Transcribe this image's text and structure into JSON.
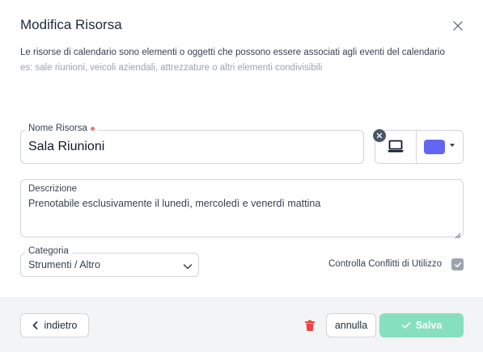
{
  "dialog": {
    "title": "Modifica Risorsa",
    "description": "Le risorse di calendario sono elementi o oggetti che possono essere associati agli eventi del calendario",
    "examples": "es: sale riunioni, veicoli aziendali, attrezzature o altri elementi condivisibili"
  },
  "form": {
    "name": {
      "label": "Nome Risorsa",
      "value": "Sala Riunioni",
      "required": true
    },
    "icon": {
      "name": "laptop-icon"
    },
    "color": {
      "value": "#6366f1"
    },
    "description": {
      "label": "Descrizione",
      "value": "Prenotabile esclusivamente il lunedì, mercoledì e venerdì mattina"
    },
    "category": {
      "label": "Categoria",
      "value": "Strumenti / Altro"
    },
    "conflicts": {
      "label": "Controlla Conflitti di Utilizzo",
      "checked": true
    }
  },
  "footer": {
    "back_label": "indietro",
    "cancel_label": "annulla",
    "save_label": "Salva"
  },
  "colors": {
    "required_dot": "#f87171",
    "delete": "#ef4444",
    "save_bg": "#86e0bd",
    "checkbox": "#9ca3af"
  }
}
